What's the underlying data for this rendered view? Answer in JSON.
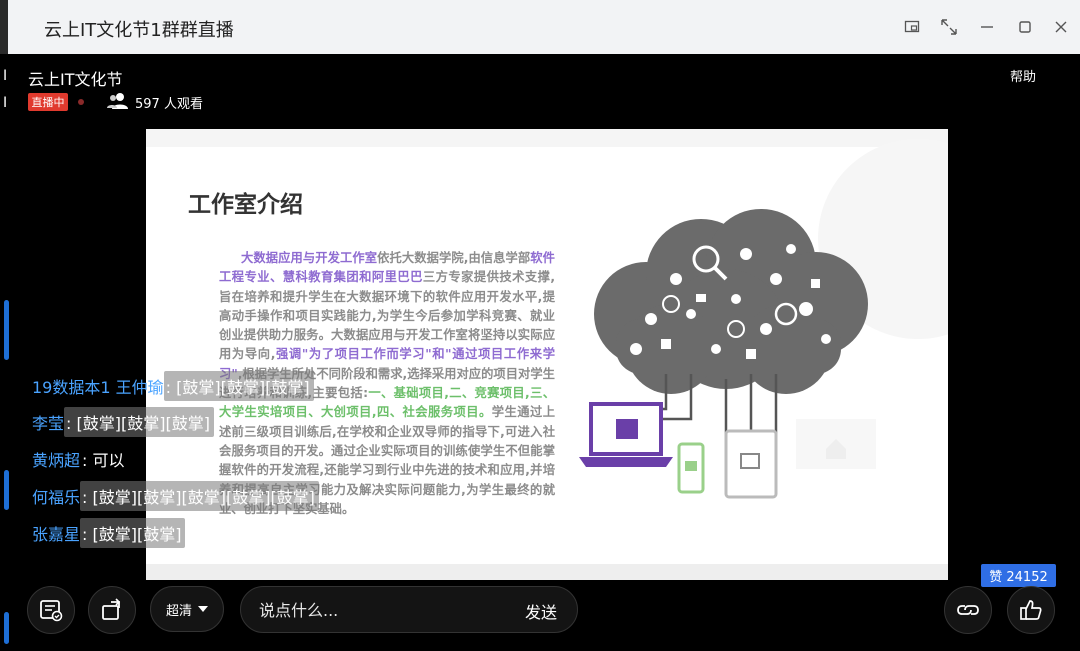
{
  "window": {
    "title": "云上IT文化节1群群直播"
  },
  "header": {
    "room_name": "云上IT文化节",
    "help_label": "帮助",
    "live_badge": "直播中",
    "viewer_count": "597 人观看"
  },
  "slide": {
    "title": "工作室介绍",
    "p1_lead": "大数据应用与开发工作室",
    "p1_a": "依托大数据学院,由信息学部",
    "p1_partners": "软件工程专业、慧科教育集团和阿里巴巴",
    "p1_b": "三方专家提供技术支撑,旨在培养和提升学生在大数据环境下的软件应用开发水平,提高动手操作和项目实践能力,为学生今后参加学科竞赛、就业创业提供助力服务。大数据应用与开发工作室将坚持以实际应用为导向,",
    "p1_slogan": "强调\"为了项目工作而学习\"和\"通过项目工作来学习\"",
    "p1_c": ",根据学生所处不同阶段和需求,选择采用对应的项目对学生进行培养和训练,主要包括:",
    "p1_projects": "一、基础项目,二、竞赛项目,三、大学生实培项目、大创项目,四、社会服务项目。",
    "p1_d": "学生通过上述前三级项目训练后,在学校和企业双导师的指导下,可进入社会服务项目的开发。通过企业实际项目的训练使学生不但能掌握软件的开发流程,还能学习到行业中先进的技术和应用,并培养和提高自主学习能力及解决实际问题能力,为学生最终的就业、创业打下坚实基础。"
  },
  "chat": [
    {
      "name": "19数据本1 王仲瑜",
      "sep": " : ",
      "message": "[鼓掌][鼓掌][鼓掌]"
    },
    {
      "name": "李莹",
      "sep": " : ",
      "message": "[鼓掌][鼓掌][鼓掌]"
    },
    {
      "name": "黄炳超",
      "sep": " : ",
      "message": "可以"
    },
    {
      "name": "何福乐",
      "sep": " : ",
      "message": "[鼓掌][鼓掌][鼓掌][鼓掌][鼓掌]"
    },
    {
      "name": "张嘉星",
      "sep": " : ",
      "message": "[鼓掌][鼓掌]"
    }
  ],
  "likes": {
    "label": "赞 24152"
  },
  "toolbar": {
    "quality_label": "超清",
    "comment_placeholder": "说点什么...",
    "send_label": "发送"
  },
  "colors": {
    "live_red": "#e03a2e",
    "accent_blue": "#2f6ee5",
    "chat_name_blue": "#4aa3ff",
    "slide_purple": "#8e6bd1",
    "slide_green": "#6cbf6a"
  },
  "icons": {
    "window_controls": [
      "pip-icon",
      "fullscreen-icon",
      "minimize-icon",
      "maximize-icon",
      "close-icon"
    ],
    "toolbar": [
      "notes-icon",
      "rotate-icon",
      "chevron-down-icon",
      "share-link-icon",
      "thumbs-up-icon"
    ]
  }
}
